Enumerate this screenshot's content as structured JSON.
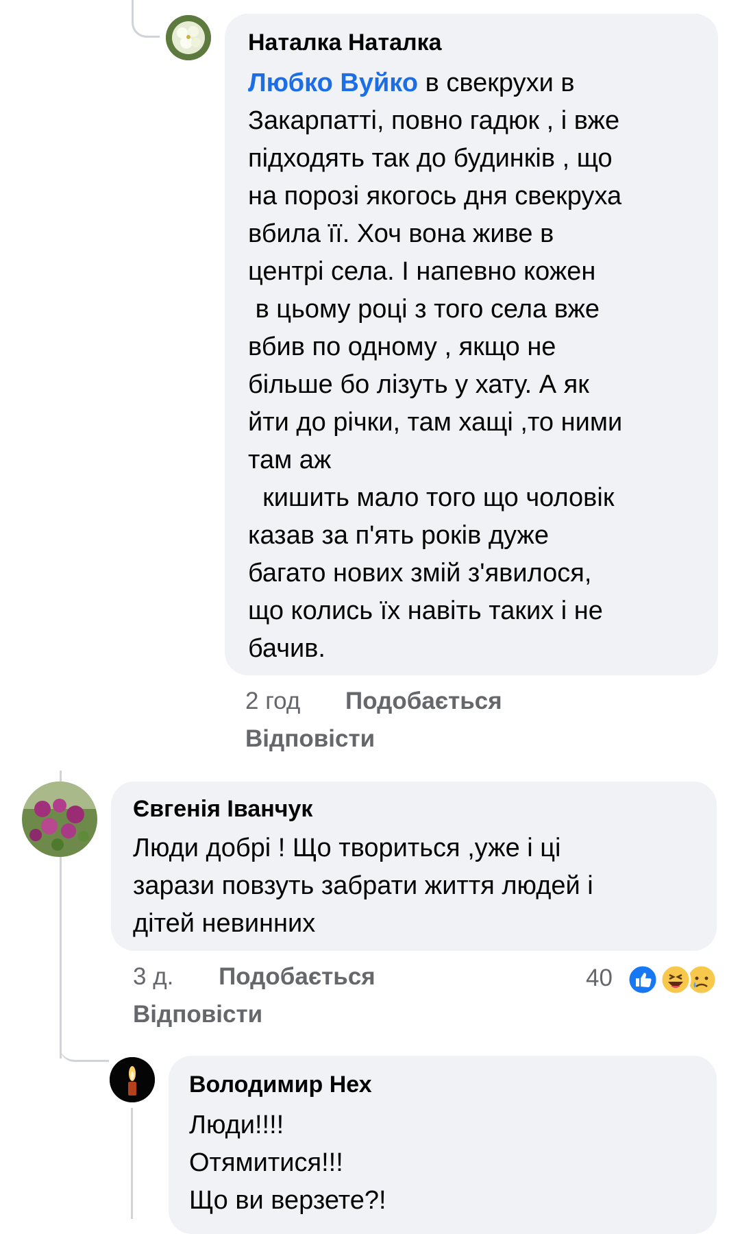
{
  "comments": [
    {
      "author": "Наталка Наталка",
      "mention": "Любко Вуйко",
      "text_first": " в свекрухи в",
      "text_rest": "Закарпатті, повно гадюк , і вже\nпідходять так до будинків , що\nна порозі якогось дня свекруха\nвбила її. Хоч вона живе в\nцентрі села. І напевно кожен\n в цьому році з того села вже\nвбив по одному , якщо не\nбільше бо лізуть у хату. А як\nйти до річки, там хащі ,то ними\nтам аж\n  кишить мало того що чоловік\nказав за п'ять років дуже\nбагато нових змій з'явилося,\nщо колись їх навіть таких і не\nбачив.",
      "time": "2 год",
      "like_label": "Подобається",
      "reply_label": "Відповісти"
    },
    {
      "author": "Євгенія Іванчук",
      "text": "Люди добрі ! Що твориться ,уже і ці\nзарази повзуть забрати життя людей і\nдітей невинних",
      "time": "3 д.",
      "like_label": "Подобається",
      "reply_label": "Відповісти",
      "reaction_count": "40",
      "reactions": [
        "like-icon",
        "haha-icon",
        "sad-icon"
      ]
    },
    {
      "author": "Володимир Нех",
      "text": "Люди!!!!\nОтямитися!!!\nЩо ви верзете?!"
    }
  ],
  "colors": {
    "bubble": "#f0f2f5",
    "mention": "#1b6ee6",
    "meta": "#65676b",
    "like_blue": "#1877f2",
    "haha_yellow": "#f7c84b"
  }
}
